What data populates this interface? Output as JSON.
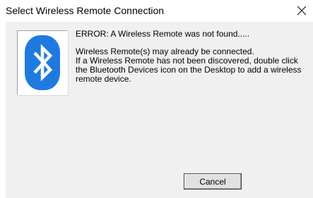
{
  "window": {
    "title": "Select Wireless Remote Connection"
  },
  "icon": {
    "name": "bluetooth-icon",
    "color": "#1f7ae0"
  },
  "message": {
    "error": "ERROR: A Wireless Remote was not found.....",
    "lines": [
      "Wireless Remote(s) may already be connected.",
      "If a Wireless Remote has not been discovered, double click",
      "the Bluetooth Devices icon on the Desktop to add a wireless",
      "remote device."
    ]
  },
  "buttons": {
    "cancel_label": "Cancel"
  }
}
